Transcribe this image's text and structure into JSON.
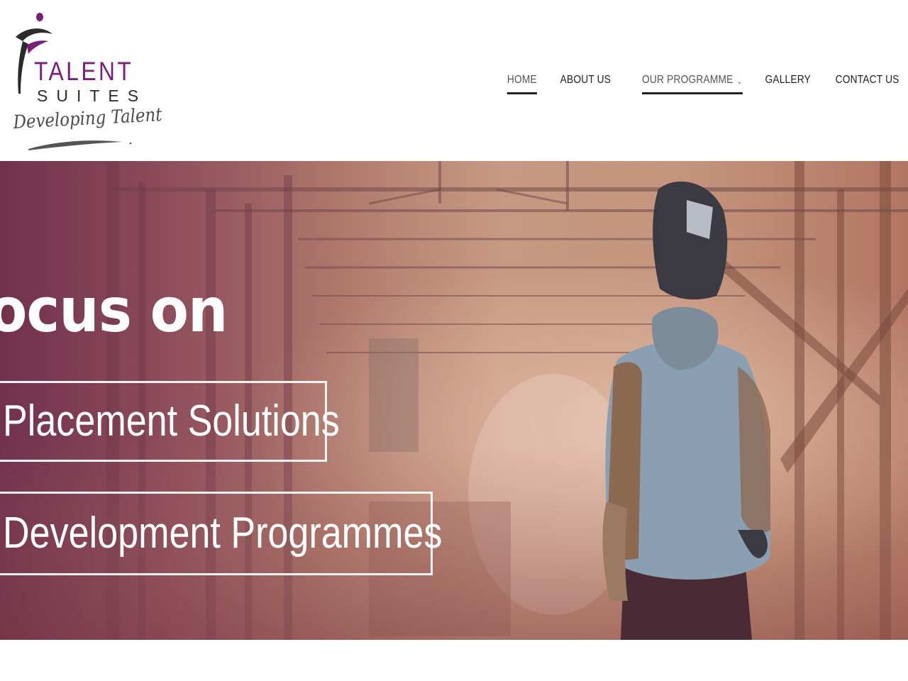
{
  "brand": {
    "name_line1": "TALENT",
    "name_line2": "SUITES",
    "tagline": "Developing Talent",
    "primary_color": "#7a1f78",
    "dark_color": "#2b2b2b"
  },
  "nav": {
    "items": [
      {
        "label": "HOME",
        "active": true
      },
      {
        "label": "ABOUT US",
        "active": false
      },
      {
        "label": "OUR PROGRAMME",
        "active": true,
        "has_dropdown": true,
        "dropdown_icon": "chevron-down-icon"
      },
      {
        "label": "GALLERY",
        "active": false
      },
      {
        "label": "CONTACT US",
        "active": false
      }
    ]
  },
  "hero": {
    "headline": "ocus on",
    "boxes": [
      {
        "label": "Placement Solutions"
      },
      {
        "label": "Development Programmes"
      }
    ],
    "image_subject": "welder in protective helmet walking through industrial workshop",
    "tint_color": "#7a3b52"
  }
}
